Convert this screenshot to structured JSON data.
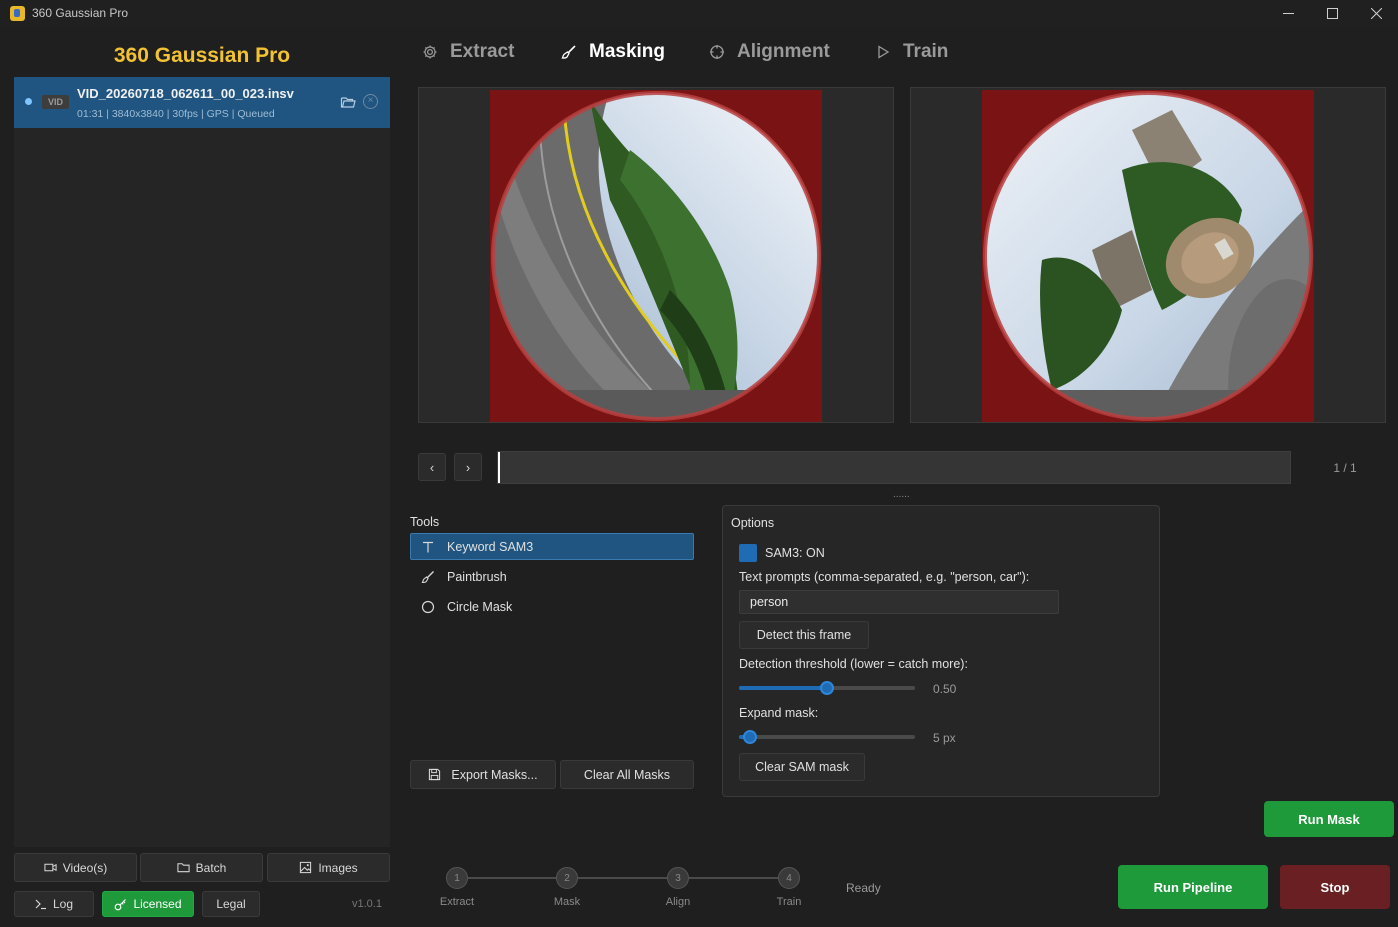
{
  "window": {
    "title": "360 Gaussian Pro"
  },
  "sidebar": {
    "brand": "360 Gaussian Pro",
    "files": [
      {
        "badge": "VID",
        "name": "VID_20260718_062611_00_023.insv",
        "meta": "01:31 | 3840x3840 | 30fps | GPS | Queued"
      }
    ],
    "source_buttons": {
      "videos": "Video(s)",
      "batch": "Batch",
      "images": "Images"
    },
    "footer": {
      "log": "Log",
      "licensed": "Licensed",
      "legal": "Legal",
      "version": "v1.0.1"
    }
  },
  "tabs": [
    {
      "label": "Extract",
      "icon": "gear-icon"
    },
    {
      "label": "Masking",
      "icon": "paintbrush-icon",
      "active": true
    },
    {
      "label": "Alignment",
      "icon": "crosshair-icon"
    },
    {
      "label": "Train",
      "icon": "play-icon"
    }
  ],
  "timeline": {
    "prev": "‹",
    "next": "›",
    "counter": "1 / 1",
    "splitter": "......"
  },
  "tools": {
    "label": "Tools",
    "items": [
      {
        "label": "Keyword SAM3",
        "icon": "text-icon",
        "active": true
      },
      {
        "label": "Paintbrush",
        "icon": "paintbrush-icon"
      },
      {
        "label": "Circle Mask",
        "icon": "circle-icon"
      }
    ],
    "export": "Export Masks...",
    "clear_all": "Clear All Masks"
  },
  "options": {
    "label": "Options",
    "sam_toggle": "SAM3: ON",
    "prompt_label": "Text prompts (comma-separated, e.g. \"person, car\"):",
    "prompt_value": "person",
    "detect_button": "Detect this frame",
    "threshold_label": "Detection threshold (lower = catch more):",
    "threshold_value": "0.50",
    "threshold_fraction": 0.5,
    "expand_label": "Expand mask:",
    "expand_value": "5 px",
    "expand_fraction": 0.06,
    "clear_sam": "Clear SAM mask"
  },
  "actions": {
    "run_mask": "Run Mask",
    "run_pipeline": "Run Pipeline",
    "stop": "Stop"
  },
  "pipeline": {
    "steps": [
      {
        "num": "1",
        "label": "Extract"
      },
      {
        "num": "2",
        "label": "Mask"
      },
      {
        "num": "3",
        "label": "Align"
      },
      {
        "num": "4",
        "label": "Train"
      }
    ],
    "status": "Ready"
  },
  "colors": {
    "accent": "#1f6cb5",
    "brand": "#f2c233",
    "success": "#1e9a3a",
    "danger": "#6a1f22",
    "mask": "#7a1414"
  }
}
